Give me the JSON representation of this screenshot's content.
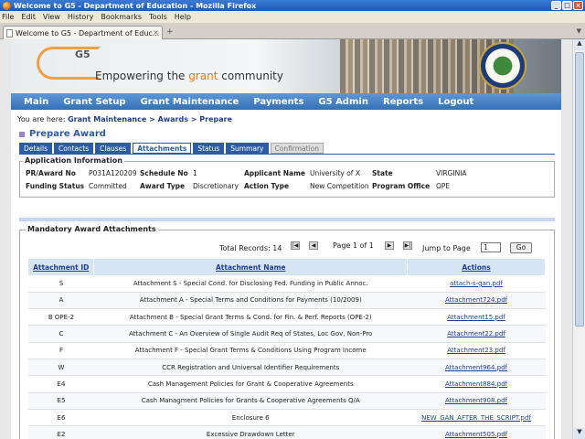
{
  "window": {
    "title": "Welcome to G5 - Department of Education - Mozilla Firefox"
  },
  "menu": [
    "File",
    "Edit",
    "View",
    "History",
    "Bookmarks",
    "Tools",
    "Help"
  ],
  "browser_tab": {
    "label": "Welcome to G5 - Department of Educ...",
    "new_tab": "+"
  },
  "banner": {
    "logo": "G5",
    "tagline_pre": "Empowering the ",
    "tagline_grant": "grant",
    "tagline_post": " community"
  },
  "nav": [
    "Main",
    "Grant Setup",
    "Grant Maintenance",
    "Payments",
    "G5 Admin",
    "Reports",
    "Logout"
  ],
  "breadcrumb": {
    "prefix": "You are here: ",
    "trail": "Grant Maintenance > Awards > Prepare"
  },
  "page_title": "Prepare Award",
  "subtabs": [
    "Details",
    "Contacts",
    "Clauses",
    "Attachments",
    "Status",
    "Summary",
    "Confirmation"
  ],
  "app_info": {
    "legend": "Application Information",
    "pr_award_label": "PR/Award No",
    "pr_award": "P031A120209",
    "schedule_label": "Schedule No",
    "schedule": "1",
    "applicant_label": "Applicant Name",
    "applicant": "University of X",
    "state_label": "State",
    "state": "VIRGINIA",
    "funding_label": "Funding Status",
    "funding": "Committed",
    "award_type_label": "Award Type",
    "award_type": "Discretionary",
    "action_type_label": "Action Type",
    "action_type": "New Competition",
    "program_office_label": "Program Office",
    "program_office": "OPE"
  },
  "attachments": {
    "legend": "Mandatory Award Attachments",
    "total_records": "Total Records: 14",
    "page_info": "Page 1 of 1",
    "jump_label": "Jump to Page",
    "jump_value": "1",
    "go": "Go",
    "headers": [
      "Attachment ID",
      "Attachment Name",
      "Actions"
    ],
    "rows": [
      [
        "S",
        "Attachment S - Special Cond. for Disclosing Fed. Funding in Public Annoc.",
        "attach-s-gan.pdf"
      ],
      [
        "A",
        "Attachment A - Special Terms and Conditions for Payments (10/2009)",
        "Attachment724.pdf"
      ],
      [
        "B OPE-2",
        "Attachment B - Special Grant Terms & Cond. for Fin. & Perf. Reports (OPE-2)",
        "Attachment15.pdf"
      ],
      [
        "C",
        "Attachment C - An Overview of Single Audit Req of States, Loc Gov, Non-Pro",
        "Attachment22.pdf"
      ],
      [
        "F",
        "Attachment F - Special Grant Terms & Conditions Using Program Income",
        "Attachment23.pdf"
      ],
      [
        "W",
        "CCR Registration and Universal Identifier Requirements",
        "Attachment964.pdf"
      ],
      [
        "E4",
        "Cash Management Policies for Grant & Cooperative Agreements",
        "Attachment884.pdf"
      ],
      [
        "E5",
        "Cash Managment Policies for Grants & Cooperative Agreements Q/A",
        "Attachment908.pdf"
      ],
      [
        "E6",
        "Enclosure 6",
        "NEW_GAN_AFTER_THE_SCRIPT.pdf"
      ],
      [
        "E2",
        "Excessive Drawdown Letter",
        "Attachment505.pdf"
      ]
    ]
  }
}
